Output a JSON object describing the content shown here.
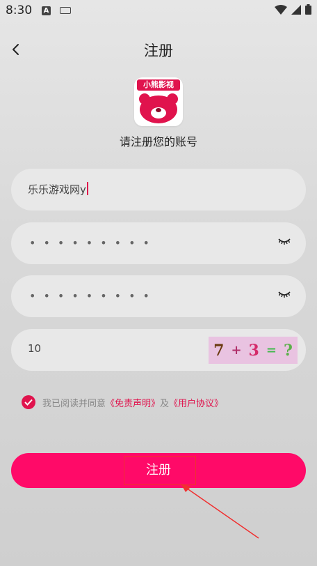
{
  "status_bar": {
    "time": "8:30",
    "a_indicator": "A",
    "icons": [
      "keyboard-icon",
      "wifi-icon",
      "signal-icon",
      "battery-icon"
    ]
  },
  "header": {
    "title": "注册",
    "back_icon": "chevron-left-icon"
  },
  "logo": {
    "banner_text": "小熊影视",
    "accent_color": "#e0134d"
  },
  "subtitle": "请注册您的账号",
  "form": {
    "username": {
      "value": "乐乐游戏网y"
    },
    "password": {
      "masked": "•••••••••"
    },
    "confirm_password": {
      "masked": "•••••••••"
    },
    "captcha_input": {
      "value": "10"
    },
    "captcha_image": {
      "a": "7",
      "op": "+",
      "b": "3",
      "eq": "=",
      "q": "?"
    }
  },
  "agreement": {
    "checked": true,
    "prefix": "我已阅读并同意",
    "link1": "《免责声明》",
    "conjunction": "及",
    "link2": "《用户协议》"
  },
  "register_button": {
    "label": "注册",
    "color": "#ff0a68"
  },
  "annotation_color": "#f03030"
}
